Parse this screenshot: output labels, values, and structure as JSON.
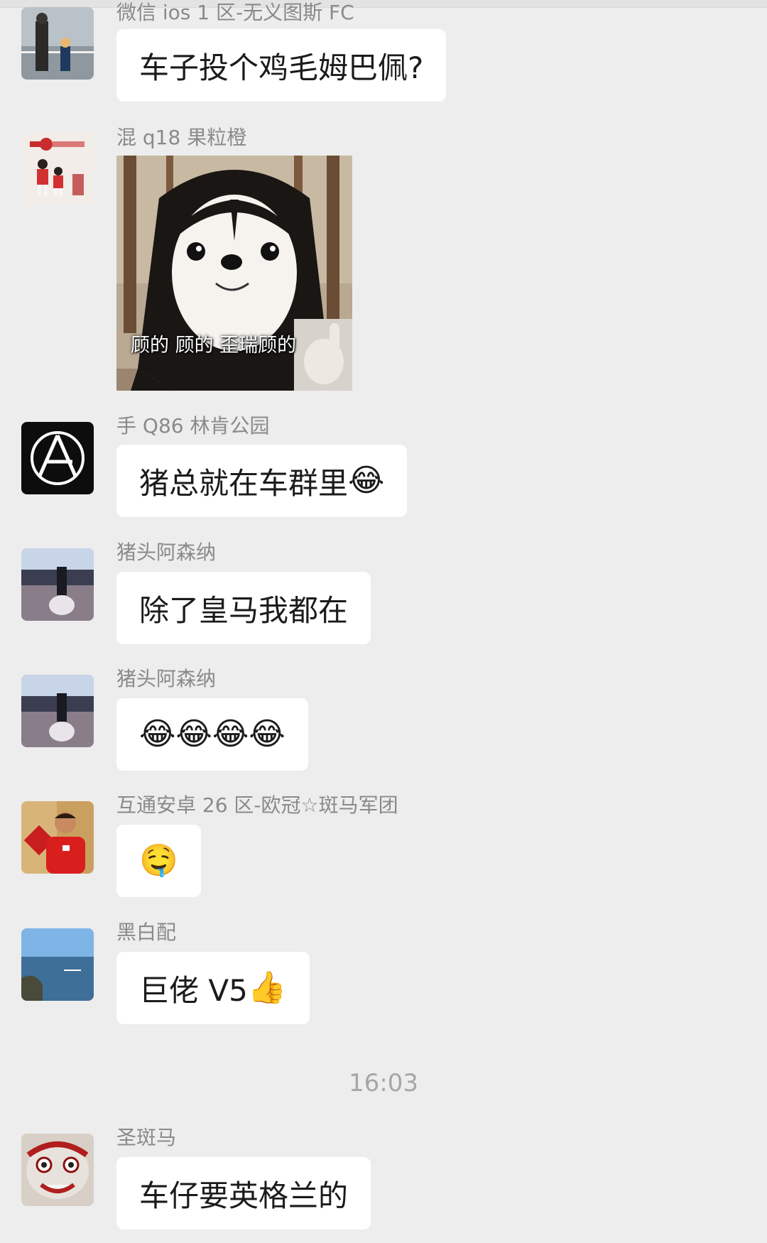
{
  "messages": [
    {
      "sender": "微信 ios 1 区-无义图斯 FC",
      "text": "车子投个鸡毛姆巴佩?"
    },
    {
      "sender": "混 q18 果粒橙",
      "sticker_caption": "顾的 顾的 歪瑞顾的"
    },
    {
      "sender": "手 Q86 林肯公园",
      "text": "猪总就在车群里",
      "emoji": "😂"
    },
    {
      "sender": "猪头阿森纳",
      "text": "除了皇马我都在"
    },
    {
      "sender": "猪头阿森纳",
      "emoji": "😂😂😂😂"
    },
    {
      "sender": "互通安卓 26 区-欧冠☆斑马军团",
      "emoji": "🤤"
    },
    {
      "sender": "黑白配",
      "text": "巨佬 V5",
      "emoji": "👍"
    },
    {
      "sender": "圣斑马",
      "text": "车仔要英格兰的"
    }
  ],
  "timestamp": "16:03",
  "icons": {
    "avatar_linkinpark": "linkin-park-logo-icon"
  },
  "colors": {
    "background": "#ededed",
    "bubble": "#ffffff",
    "sender": "#8a8a8a",
    "text": "#1b1b1b",
    "timestamp": "#a6a6a6"
  }
}
